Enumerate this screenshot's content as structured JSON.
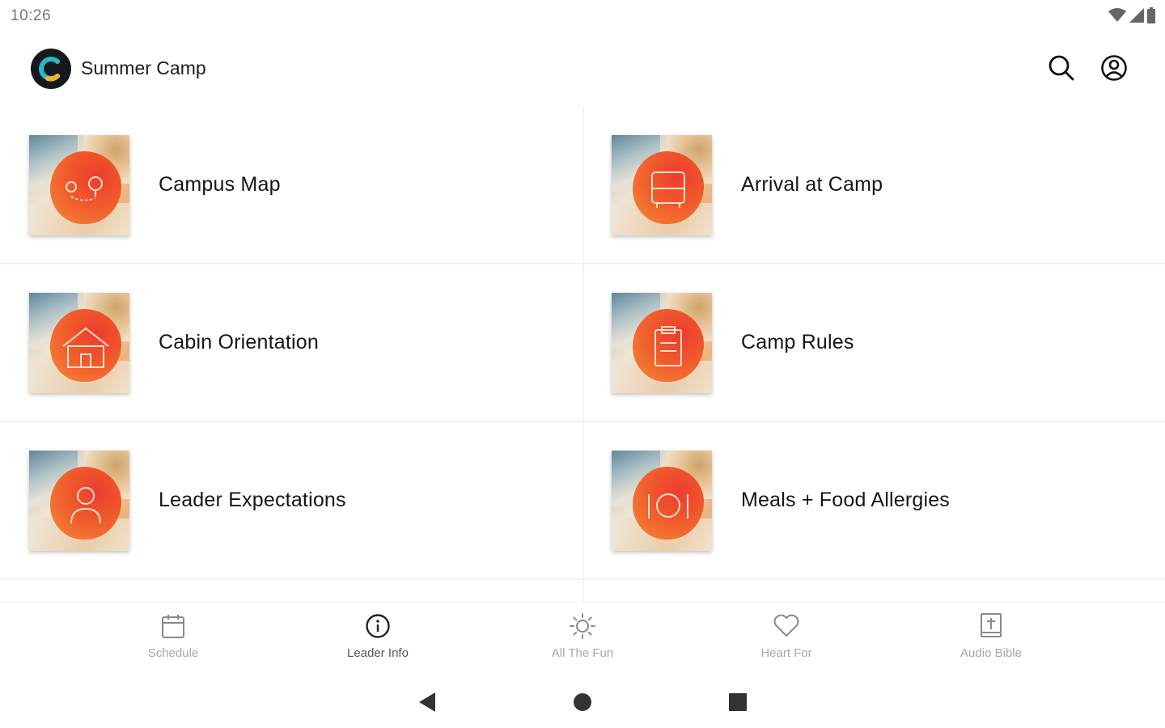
{
  "status_bar": {
    "time": "10:26"
  },
  "header": {
    "title": "Summer Camp"
  },
  "tiles": [
    {
      "label": "Campus Map"
    },
    {
      "label": "Arrival at Camp"
    },
    {
      "label": "Cabin Orientation"
    },
    {
      "label": "Camp Rules"
    },
    {
      "label": "Leader Expectations"
    },
    {
      "label": "Meals + Food Allergies"
    }
  ],
  "bottom_nav": {
    "active_index": 1,
    "items": [
      {
        "label": "Schedule",
        "icon": "calendar-icon"
      },
      {
        "label": "Leader Info",
        "icon": "info-icon"
      },
      {
        "label": "All The Fun",
        "icon": "sun-icon"
      },
      {
        "label": "Heart For",
        "icon": "heart-icon"
      },
      {
        "label": "Audio Bible",
        "icon": "bible-icon"
      }
    ]
  },
  "colors": {
    "accent_orange": "#f37a33",
    "accent_red": "#ee3b2f",
    "logo_bg": "#16191c",
    "logo_teal": "#2ab7c9",
    "logo_gold": "#f2b12b"
  }
}
